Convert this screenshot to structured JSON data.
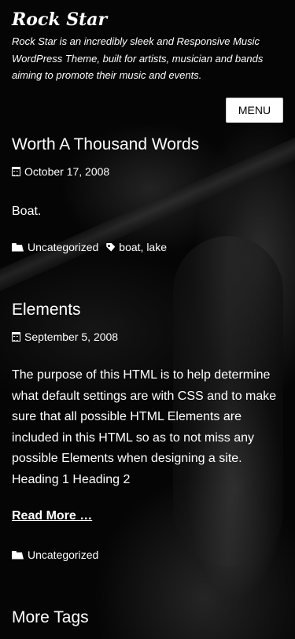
{
  "site": {
    "title": "Rock Star",
    "description": "Rock Star is an incredibly sleek and Responsive Music WordPress Theme, built for artists, musician and bands aiming to promote their music and events."
  },
  "menu": {
    "label": "MENU"
  },
  "posts": [
    {
      "title": "Worth A Thousand Words",
      "date": "October 17, 2008",
      "excerpt": "Boat.",
      "category": "Uncategorized",
      "tags": [
        "boat",
        "lake"
      ]
    },
    {
      "title": "Elements",
      "date": "September 5, 2008",
      "excerpt": "The purpose of this HTML is to help determine what default settings are with CSS and to make sure that all possible HTML Elements are included in this HTML so as to not miss any possible Elements when designing a site. Heading 1 Heading 2",
      "read_more": "Read More …",
      "category": "Uncategorized"
    }
  ],
  "widget": {
    "title": "More Tags"
  },
  "icons": {
    "date": "calendar-icon",
    "category": "folder-open-icon",
    "tags": "tag-icon"
  },
  "colors": {
    "background": "#000000",
    "text": "#ffffff",
    "button_bg": "#ffffff",
    "button_text": "#000000"
  }
}
